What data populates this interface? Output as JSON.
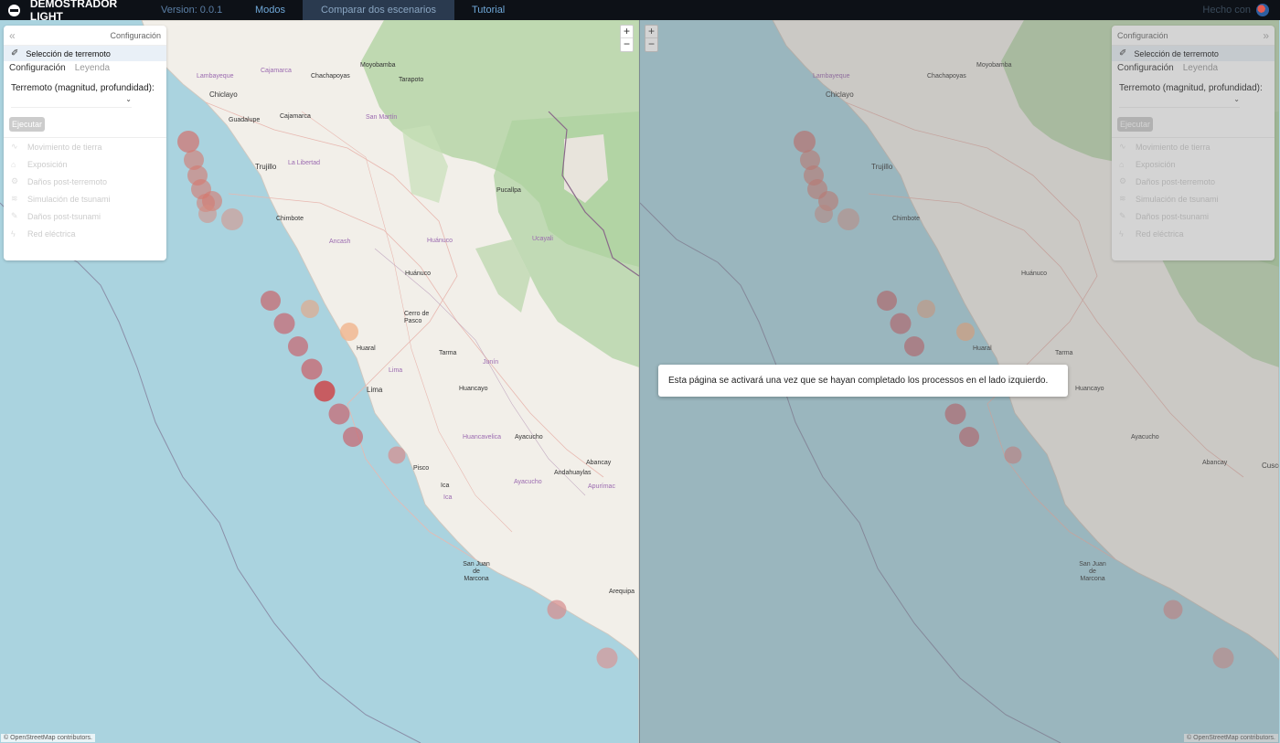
{
  "navbar": {
    "brand": "DEMOSTRADOR LIGHT",
    "version": "Version: 0.0.1",
    "links": [
      "Modos",
      "Comparar dos escenarios",
      "Tutorial"
    ],
    "made_with": "Hecho con"
  },
  "panel": {
    "title": "Configuración",
    "selection": "Selección de terremoto",
    "tabs": [
      "Configuración",
      "Leyenda"
    ],
    "field_label": "Terremoto (magnitud, profundidad):",
    "run_button": "Ejecutar",
    "modules": [
      {
        "label": "Movimiento de tierra",
        "icon": "wave-icon"
      },
      {
        "label": "Exposición",
        "icon": "house-icon"
      },
      {
        "label": "Daños post-terremoto",
        "icon": "gear-icon"
      },
      {
        "label": "Simulación de tsunami",
        "icon": "tsunami-icon"
      },
      {
        "label": "Daños post-tsunami",
        "icon": "brush-icon"
      },
      {
        "label": "Red eléctrica",
        "icon": "bolt-icon"
      }
    ]
  },
  "map": {
    "zoom_in": "+",
    "zoom_out": "−",
    "attribution": "© OpenStreetMap contributors.",
    "labels": [
      {
        "text": "Lambayeque",
        "purple": true
      },
      {
        "text": "Chiclayo",
        "purple": false
      },
      {
        "text": "Cajamarca",
        "purple": true
      },
      {
        "text": "Chachapoyas",
        "purple": false
      },
      {
        "text": "Moyobamba",
        "purple": false
      },
      {
        "text": "Tarapoto",
        "purple": false
      },
      {
        "text": "Guadalupe",
        "purple": false
      },
      {
        "text": "Cajamarca",
        "purple": false
      },
      {
        "text": "San Martín",
        "purple": true
      },
      {
        "text": "Trujillo",
        "purple": false
      },
      {
        "text": "La Libertad",
        "purple": true
      },
      {
        "text": "Chimbote",
        "purple": false
      },
      {
        "text": "Ancash",
        "purple": true
      },
      {
        "text": "Huánuco",
        "purple": true
      },
      {
        "text": "Pucallpa",
        "purple": false
      },
      {
        "text": "Ucayali",
        "purple": true
      },
      {
        "text": "Huánuco",
        "purple": false
      },
      {
        "text": "Cerro de Pasco",
        "purple": false
      },
      {
        "text": "Huaral",
        "purple": false
      },
      {
        "text": "Tarma",
        "purple": false
      },
      {
        "text": "Junín",
        "purple": true
      },
      {
        "text": "Lima",
        "purple": true
      },
      {
        "text": "Lima",
        "purple": false
      },
      {
        "text": "Huancayo",
        "purple": false
      },
      {
        "text": "Huancavelica",
        "purple": true
      },
      {
        "text": "Ayacucho",
        "purple": false
      },
      {
        "text": "Abancay",
        "purple": false
      },
      {
        "text": "Pisco",
        "purple": false
      },
      {
        "text": "Andahuaylas",
        "purple": false
      },
      {
        "text": "Ica",
        "purple": false
      },
      {
        "text": "Ica",
        "purple": true
      },
      {
        "text": "Ayacucho",
        "purple": true
      },
      {
        "text": "Apurímac",
        "purple": true
      },
      {
        "text": "San Juan de Marcona",
        "purple": false
      },
      {
        "text": "Arequipa",
        "purple": false
      }
    ],
    "right_labels": [
      {
        "text": "Cusco",
        "purple": false
      }
    ]
  },
  "overlay": {
    "message": "Esta página se activará una vez que se hayan completado los processos en el lado izquierdo."
  }
}
